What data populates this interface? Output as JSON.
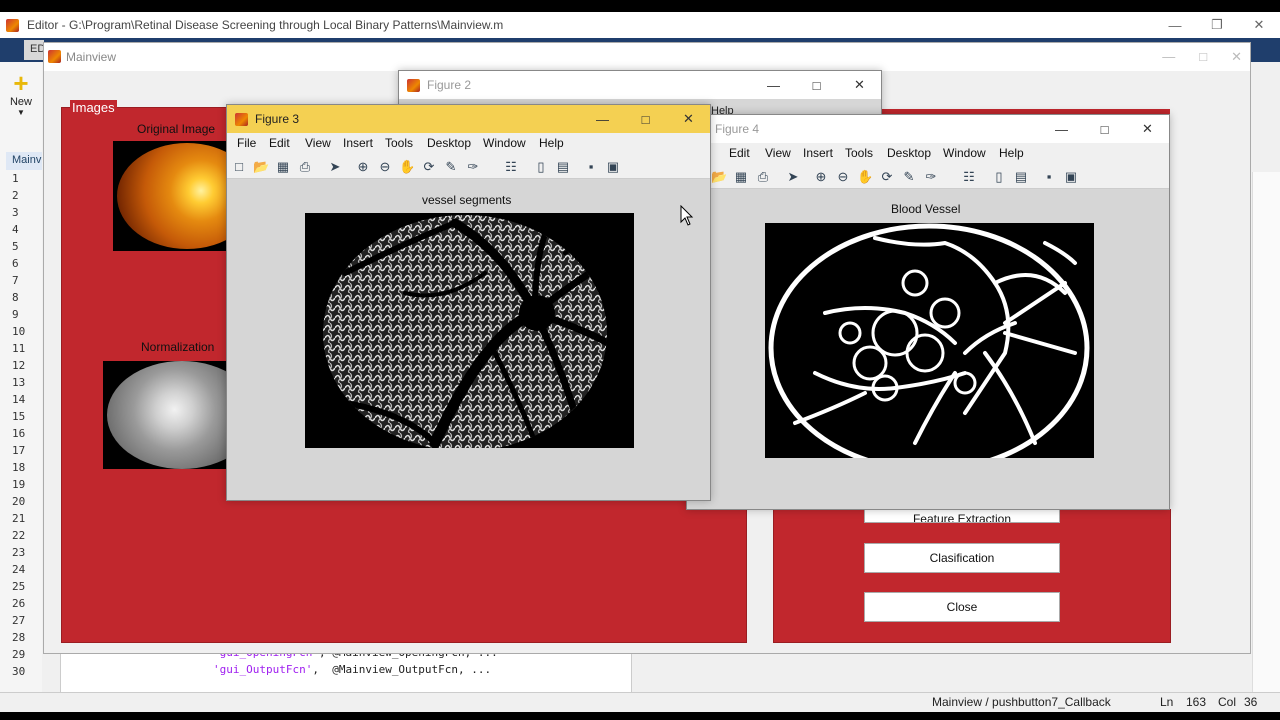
{
  "editor": {
    "title": "Editor - G:\\Program\\Retinal Disease Screening through Local Binary Patterns\\Mainview.m",
    "tab_ed": "ED",
    "new_label": "New",
    "file_tab": "Mainv",
    "line_numbers": [
      "1",
      "2",
      "3",
      "4",
      "5",
      "6",
      "7",
      "8",
      "9",
      "10",
      "11",
      "12",
      "13",
      "14",
      "15",
      "16",
      "17",
      "18",
      "19",
      "20",
      "21",
      "22",
      "23",
      "24",
      "25",
      "26",
      "27",
      "28",
      "29",
      "30"
    ],
    "code": [
      {
        "str": "'gui_OpeningFcn'",
        "rest": ", @Mainview_OpeningFcn, ..."
      },
      {
        "str": "'gui_OutputFcn'",
        "rest": ",  @Mainview_OutputFcn, ..."
      }
    ],
    "status": {
      "callback": "Mainview / pushbutton7_Callback",
      "ln_label": "Ln",
      "ln": "163",
      "col_label": "Col",
      "col": "36"
    }
  },
  "mainview": {
    "title": "Mainview",
    "panel_label": "Images",
    "original_caption": "Original  Image",
    "normalization_caption": "Normalization",
    "buttons": {
      "feature": "Feature Extraction",
      "classification": "Clasification",
      "close": "Close"
    }
  },
  "figure2": {
    "title": "Figure 2",
    "help": "Help"
  },
  "figure3": {
    "title": "Figure 3",
    "menu": [
      "File",
      "Edit",
      "View",
      "Insert",
      "Tools",
      "Desktop",
      "Window",
      "Help"
    ],
    "axes_title": "vessel segments"
  },
  "figure4": {
    "title": "Figure 4",
    "menu": [
      "Edit",
      "View",
      "Insert",
      "Tools",
      "Desktop",
      "Window",
      "Help"
    ],
    "axes_title": "Blood Vessel"
  },
  "icons": [
    "matlab-icon",
    "new-file-icon",
    "open-icon",
    "save-icon",
    "print-icon",
    "pointer-icon",
    "zoom-in-icon",
    "zoom-out-icon",
    "pan-icon",
    "rotate-icon",
    "data-cursor-icon",
    "brush-icon",
    "link-icon",
    "colorbar-icon",
    "legend-icon",
    "hide-tools-icon",
    "show-tools-icon"
  ]
}
